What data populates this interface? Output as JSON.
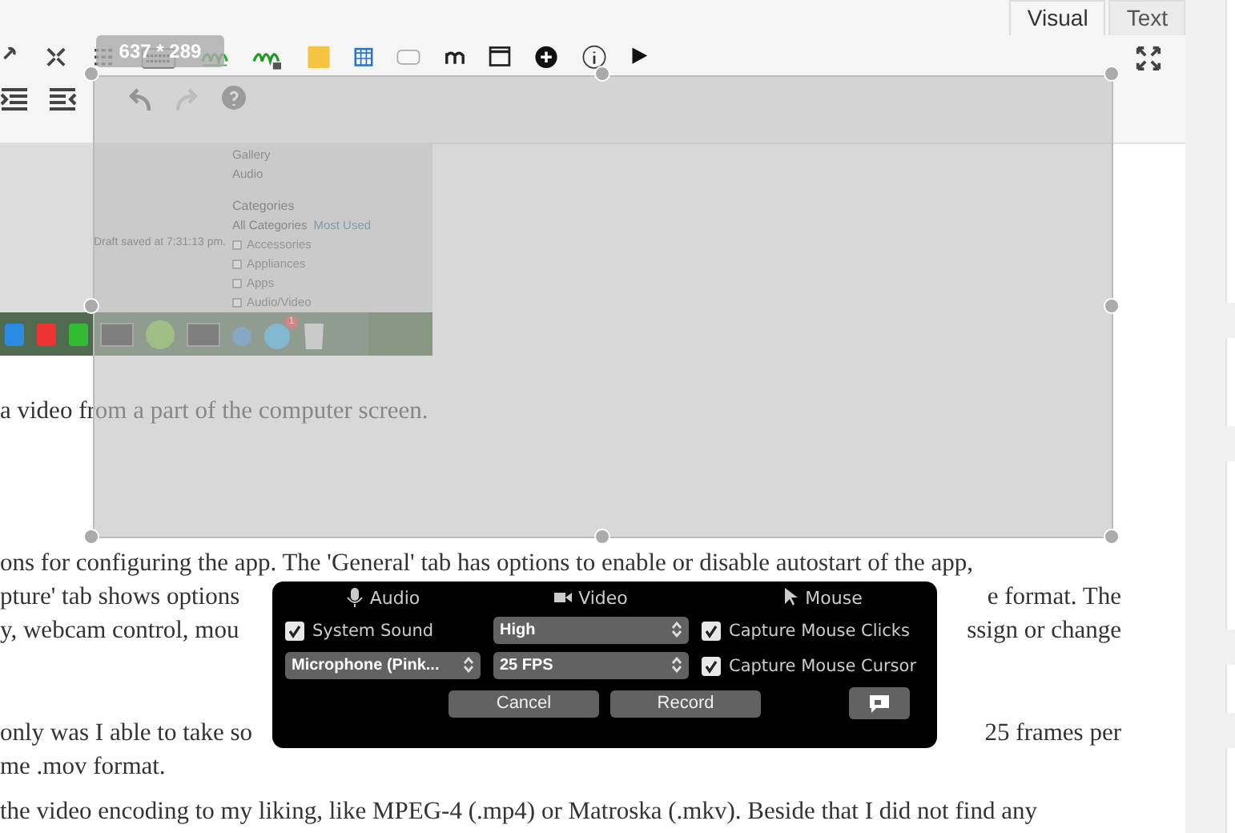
{
  "editor_tabs": [
    {
      "label": "Visual",
      "selected": true
    },
    {
      "label": "Text",
      "selected": false
    }
  ],
  "selection": {
    "size": "637 * 289"
  },
  "embedded_screenshot": {
    "post_formats": [
      "Gallery",
      "Audio"
    ],
    "draft_status": "Draft saved at 7:31:13 pm.",
    "categories_title": "Categories",
    "category_tabs": [
      {
        "label": "All Categories",
        "selected": true
      },
      {
        "label": "Most Used",
        "selected": false
      }
    ],
    "categories": [
      {
        "label": "Accessories",
        "checked": false
      },
      {
        "label": "Appliances",
        "checked": false
      },
      {
        "label": "Apps",
        "checked": false
      },
      {
        "label": "Audio/Video",
        "checked": false
      }
    ],
    "dock_badge": "1"
  },
  "paragraphs": [
    {
      "lines": [
        {
          "left": "a video from a part of the computer screen."
        }
      ]
    },
    {
      "lines": [
        {
          "left": "ons for configuring the app. The 'General' tab has options to enable or disable autostart of the app,"
        },
        {
          "left": "pture' tab shows options",
          "right": "e format. The"
        },
        {
          "left": "y, webcam control, mou",
          "right": "ssign or change"
        }
      ]
    },
    {
      "lines": [
        {
          "left": "only was I able to take so",
          "right": "25 frames per"
        },
        {
          "left": "me .mov format."
        }
      ]
    },
    {
      "lines": [
        {
          "left": "the video encoding to my liking, like MPEG-4 (.mp4) or Matroska (.mkv). Beside that I did not find any"
        }
      ]
    }
  ],
  "recorder": {
    "sections": [
      {
        "kind": "audio",
        "label": "Audio"
      },
      {
        "kind": "video",
        "label": "Video"
      },
      {
        "kind": "mouse",
        "label": "Mouse"
      }
    ],
    "rows": [
      [
        {
          "kind": "checkbox",
          "label": "System Sound",
          "checked": true
        },
        {
          "kind": "select",
          "value": "High"
        },
        {
          "kind": "checkbox",
          "label": "Capture Mouse Clicks",
          "checked": true
        }
      ],
      [
        {
          "kind": "select",
          "value": "Microphone (Pink..."
        },
        {
          "kind": "select",
          "value": "25 FPS"
        },
        {
          "kind": "checkbox",
          "label": "Capture Mouse Cursor",
          "checked": true
        }
      ]
    ],
    "buttons": [
      "Cancel",
      "Record"
    ]
  }
}
